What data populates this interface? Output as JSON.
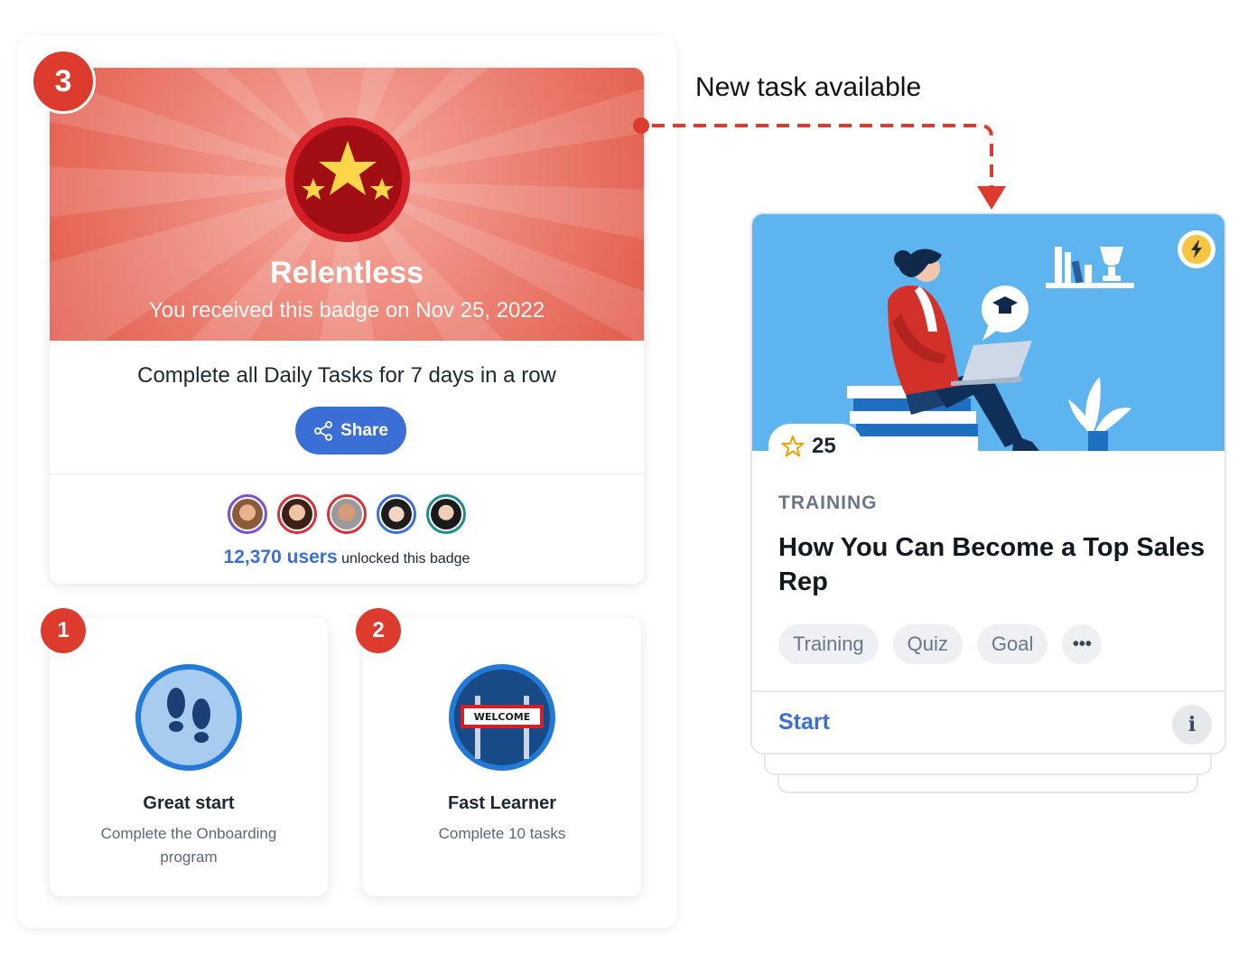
{
  "annotation": {
    "text": "New task available"
  },
  "featured_badge": {
    "step": "3",
    "name": "Relentless",
    "received": "You received this badge on Nov 25, 2022",
    "description": "Complete all Daily Tasks for 7 days in a row",
    "share_label": "Share",
    "users_count": "12,370 users",
    "users_suffix": "unlocked this badge",
    "avatar_ring_colors": [
      "#7a4fd0",
      "#d6323a",
      "#d6323a",
      "#3b6fd6",
      "#1f8c8c"
    ]
  },
  "badges": [
    {
      "step": "1",
      "name": "Great start",
      "description": "Complete the Onboarding program",
      "icon": "footprints-icon"
    },
    {
      "step": "2",
      "name": "Fast Learner",
      "description": "Complete 10 tasks",
      "icon": "welcome-sign-icon",
      "sign_text": "WELCOME"
    }
  ],
  "task": {
    "points": "25",
    "category": "TRAINING",
    "title": "How You Can Become a Top Sales Rep",
    "tags": [
      "Training",
      "Quiz",
      "Goal"
    ],
    "more_label": "•••",
    "start_label": "Start",
    "info_label": "i"
  },
  "colors": {
    "accent_red": "#dc3b2e",
    "accent_blue": "#3b6fd6",
    "hero_blue": "#5db4ef"
  }
}
